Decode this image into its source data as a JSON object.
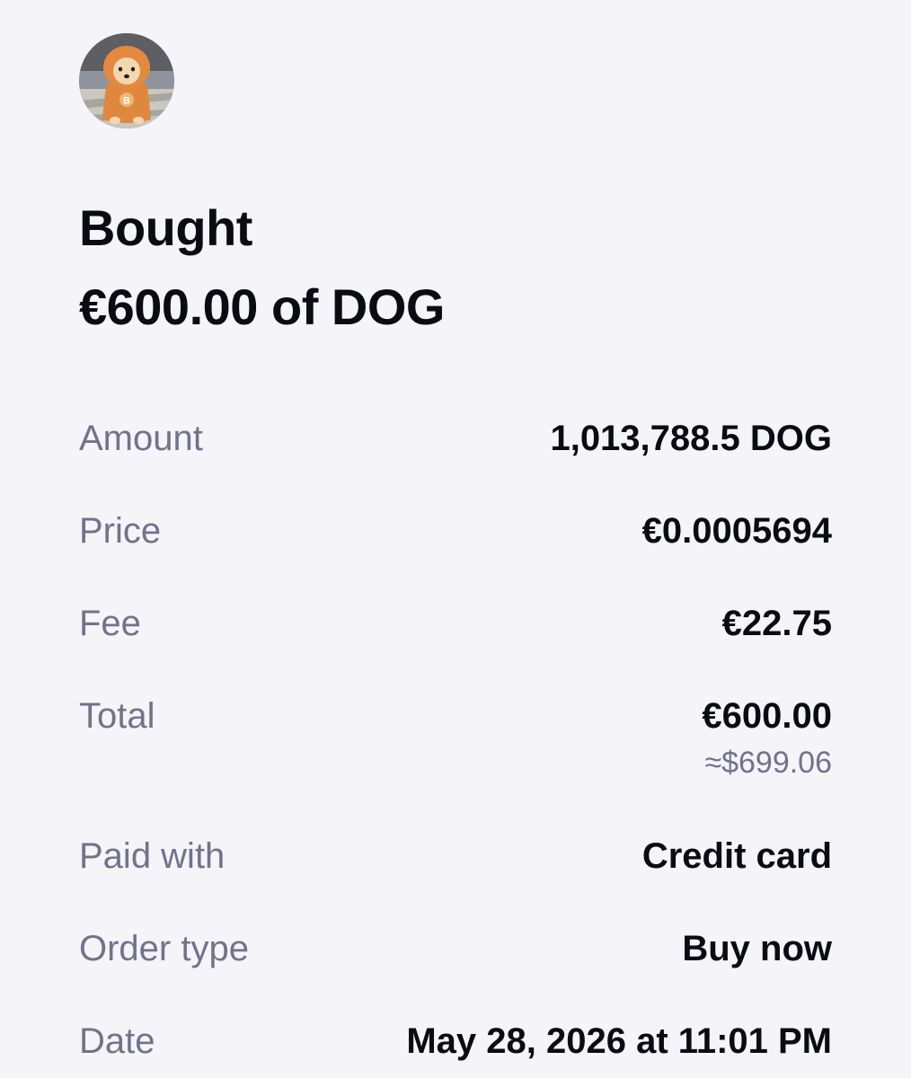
{
  "header": {
    "title_line1": "Bought",
    "title_line2": "€600.00 of DOG"
  },
  "avatar": {
    "icon": "dog-avatar-icon",
    "badge_glyph": "B"
  },
  "details": {
    "amount": {
      "label": "Amount",
      "value": "1,013,788.5 DOG"
    },
    "price": {
      "label": "Price",
      "value": "€0.0005694"
    },
    "fee": {
      "label": "Fee",
      "value": "€22.75"
    },
    "total": {
      "label": "Total",
      "value": "€600.00",
      "sub_value": "≈$699.06"
    },
    "paid_with": {
      "label": "Paid with",
      "value": "Credit card"
    },
    "order_type": {
      "label": "Order type",
      "value": "Buy now"
    },
    "date": {
      "label": "Date",
      "value": "May 28, 2026 at 11:01 PM"
    }
  },
  "colors": {
    "background": "#f4f4f9",
    "primary_text": "#0b0b14",
    "secondary_text": "#70738a",
    "hoodie": "#e0873e"
  }
}
